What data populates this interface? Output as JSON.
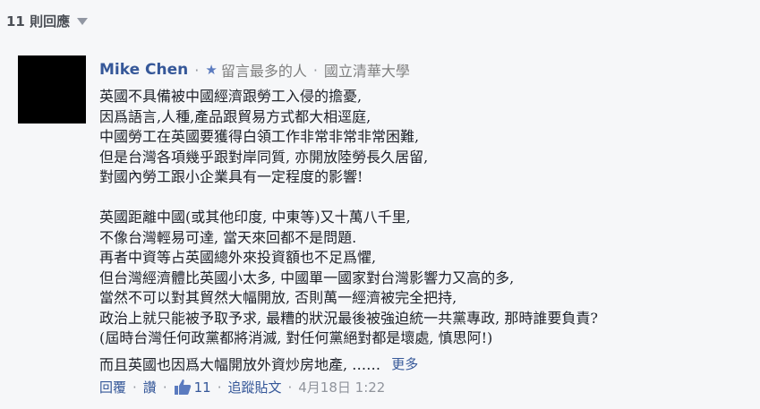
{
  "thread": {
    "reply_count_label": "11 則回應"
  },
  "comment": {
    "author": "Mike Chen",
    "badge": "留言最多的人",
    "affiliation": "國立清華大學",
    "paragraph1": [
      "英國不具備被中國經濟跟勞工入侵的擔憂,",
      "因爲語言,人種,產品跟貿易方式都大相逕庭,",
      "中國勞工在英國要獲得白領工作非常非常非常困難,",
      "但是台灣各項幾乎跟對岸同質, 亦開放陸勞長久居留,",
      "對國內勞工跟小企業具有一定程度的影響!"
    ],
    "paragraph2": [
      "英國距離中國(或其他印度, 中東等)又十萬八千里,",
      "不像台灣輕易可達, 當天來回都不是問題.",
      "再者中資等占英國總外來投資額也不足爲懼,",
      "但台灣經濟體比英國小太多, 中國單一國家對台灣影響力又高的多,",
      "當然不可以對其貿然大幅開放, 否則萬一經濟被完全把持,",
      "政治上就只能被予取予求, 最糟的狀況最後被強迫統一共黨專政, 那時誰要負責?",
      "(屆時台灣任何政黨都將消滅, 對任何黨絕對都是壞處, 慎思阿!)"
    ],
    "truncated_line": "而且英國也因爲大幅開放外資炒房地產, ……",
    "more_label": "更多",
    "actions": {
      "reply": "回覆",
      "like": "讚",
      "like_count": "11",
      "follow": "追蹤貼文",
      "timestamp": "4月18日 1:22"
    }
  },
  "colors": {
    "link": "#365899",
    "meta": "#90949c",
    "background": "#f6f7f9"
  },
  "icons": [
    "chevron-down-icon",
    "star-icon",
    "thumbs-up-icon"
  ]
}
